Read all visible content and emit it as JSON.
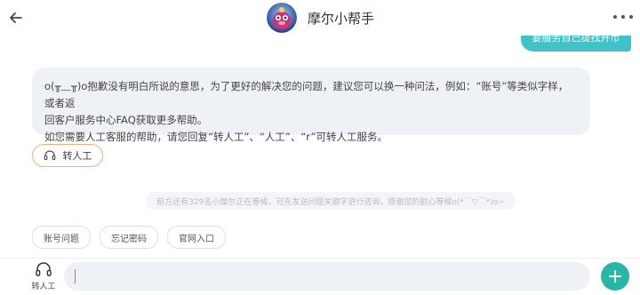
{
  "header": {
    "title": "摩尔小帮手",
    "back_icon": "arrow-left-icon",
    "more_icon": "more-dots-icon",
    "avatar": "mole-mascot-avatar"
  },
  "chat": {
    "user_message": "要服务自己提找开币",
    "bot_message": {
      "line1": "o(╥﹏╥)o抱歉没有明白所说的意思，为了更好的解决您的问题，建议您可以换一种问法，例如：“账号”等类似字样，或者返",
      "line2": "回客户服务中心FAQ获取更多帮助。",
      "line3": "如您需要人工客服的帮助，请您回复“转人工”、“人工”、“r”可转人工服务。"
    },
    "transfer_button": "转人工",
    "queue_notice": "前方还有329名小摩尔正在等候，可先发送问题关键字进行咨询，感谢您的耐心等候o(*￣▽￣*)o~"
  },
  "quick_replies": [
    "账号问题",
    "忘记密码",
    "官网入口"
  ],
  "input_bar": {
    "agent_label": "转人工",
    "placeholder": "",
    "add_icon": "plus-icon"
  },
  "colors": {
    "accent": "#26b7a6",
    "user_bubble": "#3fc3c9",
    "bot_bubble": "#eef1f6",
    "transfer_border": "#f0b27a"
  }
}
